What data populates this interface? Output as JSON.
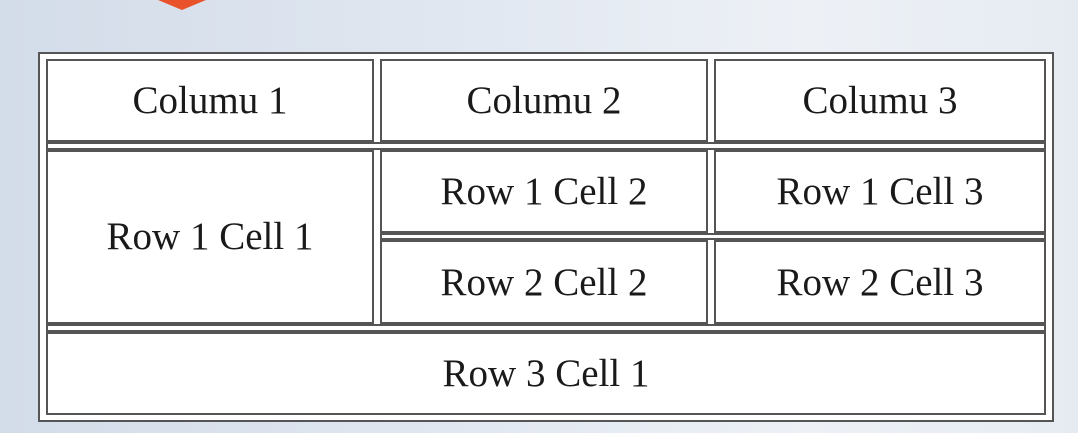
{
  "table": {
    "headers": [
      "Columu 1",
      "Columu 2",
      "Columu 3"
    ],
    "rows": [
      [
        "Row 1 Cell 1",
        "Row 1 Cell 2",
        "Row 1 Cell 3"
      ],
      [
        "Row 2 Cell 2",
        "Row 2 Cell 3"
      ],
      [
        "Row 3 Cell 1"
      ]
    ]
  },
  "colors": {
    "accent": "#e8532b",
    "border": "#555555",
    "cell_background": "#ffffff",
    "text": "#1a1a1a"
  }
}
